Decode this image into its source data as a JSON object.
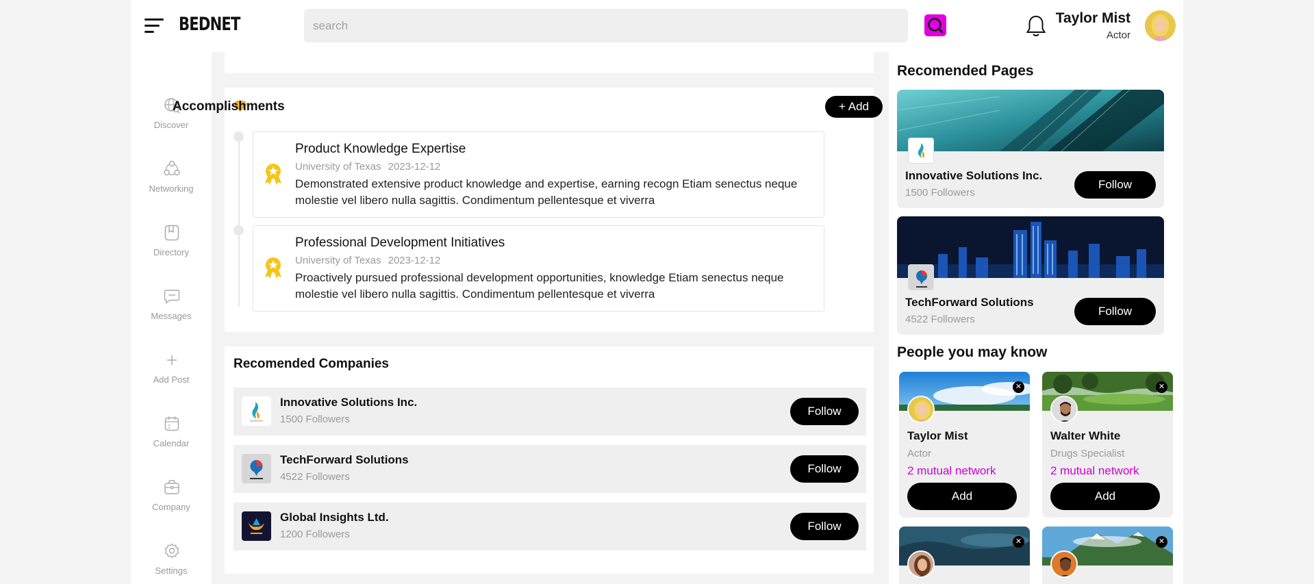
{
  "header": {
    "logo": "BEDNET",
    "search_placeholder": "search",
    "user_name": "Taylor Mist",
    "user_role": "Actor"
  },
  "sidebar": {
    "items": [
      {
        "label": "Discover",
        "icon": "globe-search-icon"
      },
      {
        "label": "Networking",
        "icon": "network-icon"
      },
      {
        "label": "Directory",
        "icon": "directory-icon"
      },
      {
        "label": "Messages",
        "icon": "message-icon"
      },
      {
        "label": "Add Post",
        "icon": "plus-icon"
      },
      {
        "label": "Calendar",
        "icon": "calendar-icon"
      },
      {
        "label": "Company",
        "icon": "briefcase-icon"
      },
      {
        "label": "Settings",
        "icon": "gear-icon"
      }
    ]
  },
  "accomplishments": {
    "title": "Accomplishments",
    "add_label": "+ Add",
    "items": [
      {
        "title": "Product Knowledge Expertise",
        "school": "University of Texas",
        "date": "2023-12-12",
        "description": "Demonstrated extensive product knowledge and expertise, earning recogn Etiam senectus neque molestie vel libero nulla sagittis. Condimentum pellentesque et viverra"
      },
      {
        "title": "Professional Development Initiatives",
        "school": "University of Texas",
        "date": "2023-12-12",
        "description": "Proactively pursued professional development opportunities, knowledge Etiam senectus neque molestie vel libero nulla sagittis. Condimentum pellentesque et viverra"
      }
    ]
  },
  "recommended_companies": {
    "title": "Recomended Companies",
    "items": [
      {
        "name": "Innovative Solutions Inc.",
        "followers": "1500 Followers",
        "button": "Follow"
      },
      {
        "name": "TechForward Solutions",
        "followers": "4522 Followers",
        "button": "Follow"
      },
      {
        "name": "Global Insights Ltd.",
        "followers": "1200 Followers",
        "button": "Follow"
      }
    ]
  },
  "recommended_pages": {
    "title": "Recomended Pages",
    "items": [
      {
        "name": "Innovative Solutions Inc.",
        "followers": "1500 Followers",
        "button": "Follow"
      },
      {
        "name": "TechForward Solutions",
        "followers": "4522 Followers",
        "button": "Follow"
      }
    ]
  },
  "people": {
    "title": "People you may know",
    "items": [
      {
        "name": "Taylor Mist",
        "role": "Actor",
        "mutual": "2 mutual network",
        "button": "Add"
      },
      {
        "name": "Walter White",
        "role": "Drugs Specialist",
        "mutual": "2 mutual network",
        "button": "Add"
      }
    ]
  },
  "colors": {
    "accent": "#e000e0",
    "mutual_text": "#d000d0",
    "button_bg": "#000000",
    "medal": "#f5c518"
  }
}
